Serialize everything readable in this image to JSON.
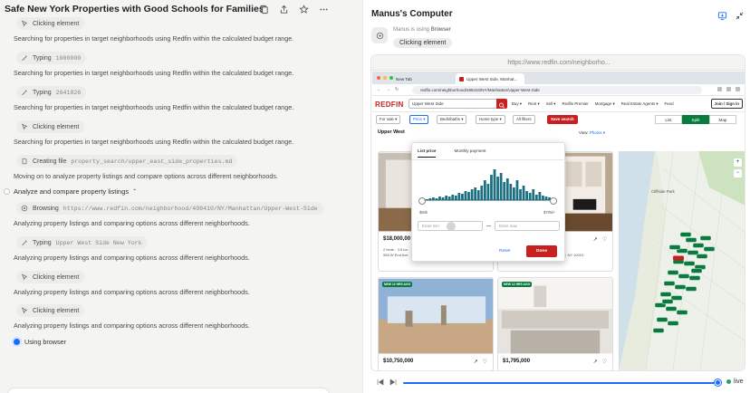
{
  "task": {
    "title": "Safe New York Properties with Good Schools for Families"
  },
  "chat": {
    "entries": [
      {
        "kind": "action",
        "icon": "cursor-icon",
        "label": "Clicking element",
        "arg": ""
      },
      {
        "kind": "message",
        "text": "Searching for properties in target neighborhoods using Redfin within the calculated budget range."
      },
      {
        "kind": "action",
        "icon": "keyboard-icon",
        "label": "Typing",
        "arg": "1000000"
      },
      {
        "kind": "message",
        "text": "Searching for properties in target neighborhoods using Redfin within the calculated budget range."
      },
      {
        "kind": "action",
        "icon": "keyboard-icon",
        "label": "Typing",
        "arg": "2641826"
      },
      {
        "kind": "message",
        "text": "Searching for properties in target neighborhoods using Redfin within the calculated budget range."
      },
      {
        "kind": "action",
        "icon": "cursor-icon",
        "label": "Clicking element",
        "arg": ""
      },
      {
        "kind": "message",
        "text": "Searching for properties in target neighborhoods using Redfin within the calculated budget range."
      },
      {
        "kind": "action",
        "icon": "file-icon",
        "label": "Creating file",
        "arg": "property_search/upper_east_side_properties.md"
      },
      {
        "kind": "message",
        "text": "Moving on to analyze property listings and compare options across different neighborhoods."
      },
      {
        "kind": "section",
        "text": "Analyze and compare property listings"
      },
      {
        "kind": "action",
        "icon": "globe-icon",
        "label": "Browsing",
        "arg": "https://www.redfin.com/neighborhood/498410/NY/Manhattan/Upper-West-Side"
      },
      {
        "kind": "message",
        "text": "Analyzing property listings and comparing options across different neighborhoods."
      },
      {
        "kind": "action",
        "icon": "keyboard-icon",
        "label": "Typing",
        "arg": "Upper West Side New York"
      },
      {
        "kind": "message",
        "text": "Analyzing property listings and comparing options across different neighborhoods."
      },
      {
        "kind": "action",
        "icon": "cursor-icon",
        "label": "Clicking element",
        "arg": ""
      },
      {
        "kind": "message",
        "text": "Analyzing property listings and comparing options across different neighborhoods."
      },
      {
        "kind": "action",
        "icon": "cursor-icon",
        "label": "Clicking element",
        "arg": ""
      },
      {
        "kind": "message",
        "text": "Analyzing property listings and comparing options across different neighborhoods."
      },
      {
        "kind": "status",
        "text": "Using browser"
      }
    ]
  },
  "computer": {
    "title": "Manus's Computer",
    "status_prefix": "Manus is using",
    "status_app": "Browser",
    "status_action": "Clicking element",
    "url": "https://www.redfin.com/neighborho..."
  },
  "browser": {
    "tab_inactive": "New Tab",
    "tab_active": "Upper West Side, Manhat...",
    "address": "redfin.com/neighborhood/498410/NY/Manhattan/Upper-West-Side"
  },
  "redfin": {
    "logo": "REDFIN",
    "search_value": "Upper West Side",
    "menu": [
      "Buy ▾",
      "Rent ▾",
      "Sell ▾",
      "Redfin Premier",
      "Mortgage ▾",
      "Real Estate Agents ▾",
      "Feed"
    ],
    "join": "Join / Sign in",
    "filters": [
      "For sale ▾",
      "Price ▾",
      "Beds/baths ▾",
      "Home type ▾",
      "All filters",
      "Save search"
    ],
    "views": [
      "List",
      "Split",
      "Map"
    ],
    "location_header": "Upper West",
    "view_label": "View:",
    "view_value": "Photos ▾",
    "price_dropdown": {
      "tabs": [
        "List price",
        "Monthly payment"
      ],
      "min_label": "$50k",
      "max_label": "$70M+",
      "min_placeholder": "Enter min",
      "max_placeholder": "Enter max",
      "reset": "Reset",
      "done": "Done"
    },
    "listings": [
      {
        "price": "$18,000,00",
        "details": "2 beds · 3.5 ba",
        "address": "555 W End Ave",
        "badge": ""
      },
      {
        "price": "",
        "details": "",
        "address": "...rk City, NY 10024",
        "badge": ""
      },
      {
        "price": "$10,750,000",
        "details": "",
        "address": "",
        "badge": "NEW 12 HRS AGO"
      },
      {
        "price": "$1,795,000",
        "details": "",
        "address": "",
        "badge": "NEW 12 HRS AGO"
      }
    ],
    "map_label": "Cliffside Park"
  },
  "player": {
    "live": "live"
  },
  "colors": {
    "accent": "#1a6cff",
    "redfin_red": "#c82021",
    "map_green": "#0a7b3e"
  }
}
